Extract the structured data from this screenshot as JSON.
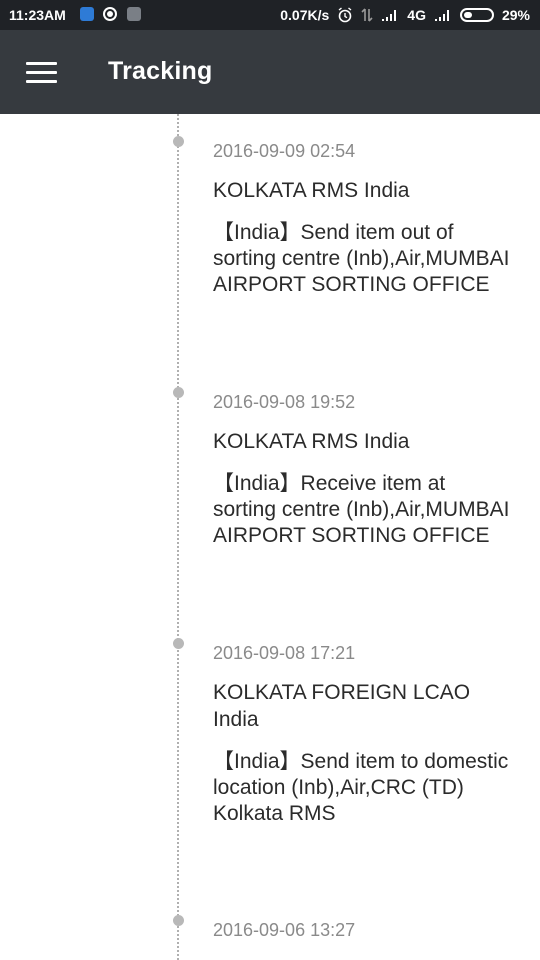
{
  "status_bar": {
    "time": "11:23AM",
    "network_speed": "0.07K/s",
    "network_type": "4G",
    "battery_percent": "29%",
    "battery_level": 0.29,
    "icons": [
      "notification-app-icon",
      "whatsapp-icon",
      "screenshot-app-icon",
      "alarm-icon",
      "data-arrows-icon",
      "signal-icon",
      "signal-icon-2",
      "battery-icon"
    ]
  },
  "app_bar": {
    "title": "Tracking",
    "menu_icon": "hamburger-menu-icon"
  },
  "events": [
    {
      "time": "2016-09-09 02:54",
      "location": "KOLKATA RMS India",
      "description": "【India】Send item out of sorting centre (Inb),Air,MUMBAI AIRPORT SORTING OFFICE"
    },
    {
      "time": "2016-09-08 19:52",
      "location": "KOLKATA RMS India",
      "description": "【India】Receive item at sorting centre (Inb),Air,MUMBAI AIRPORT SORTING OFFICE"
    },
    {
      "time": "2016-09-08 17:21",
      "location": "KOLKATA FOREIGN LCAO India",
      "description": "【India】Send item to domestic location (Inb),Air,CRC (TD) Kolkata RMS"
    },
    {
      "time": "2016-09-06 13:27",
      "location": "",
      "description": ""
    }
  ],
  "colors": {
    "status_bar_bg": "#1f2226",
    "app_bar_bg": "#363a3f",
    "timeline_dot": "#b8b8b8",
    "timestamp_text": "#8a8a8a",
    "body_text": "#2b2b2b"
  }
}
